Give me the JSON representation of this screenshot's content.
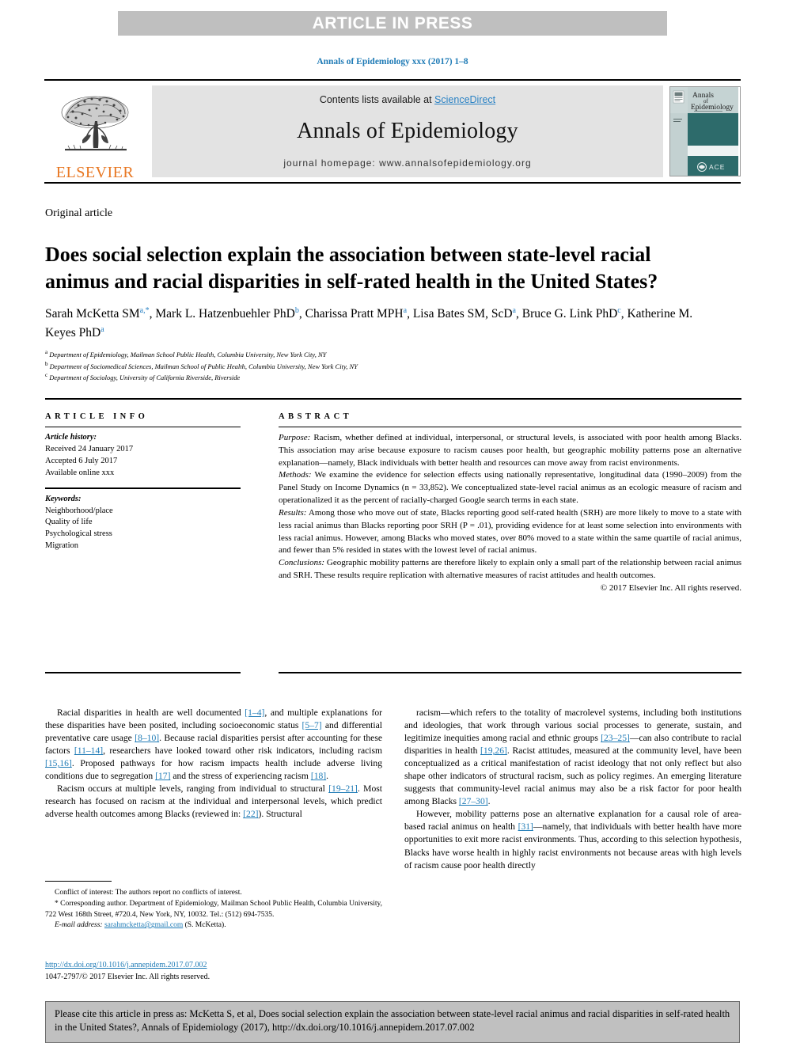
{
  "banner": {
    "text": "ARTICLE IN PRESS"
  },
  "journal_ref": "Annals of Epidemiology xxx (2017) 1–8",
  "masthead": {
    "publisher_wordmark": "ELSEVIER",
    "contents_prefix": "Contents lists available at ",
    "contents_link": "ScienceDirect",
    "journal_title": "Annals of Epidemiology",
    "homepage": "journal homepage: www.annalsofepidemiology.org",
    "cover": {
      "title_line1": "Annals",
      "title_line2": "of",
      "title_line3": "Epidemiology",
      "society": "ACE",
      "teal": "#2d6b6b"
    }
  },
  "article": {
    "type": "Original article",
    "title": "Does social selection explain the association between state-level racial animus and racial disparities in self-rated health in the United States?",
    "authors": [
      {
        "name": "Sarah McKetta SM",
        "marks": "a,*"
      },
      {
        "name": "Mark L. Hatzenbuehler PhD",
        "marks": "b"
      },
      {
        "name": "Charissa Pratt MPH",
        "marks": "a"
      },
      {
        "name": "Lisa Bates SM, ScD",
        "marks": "a"
      },
      {
        "name": "Bruce G. Link PhD",
        "marks": "c"
      },
      {
        "name": "Katherine M. Keyes PhD",
        "marks": "a"
      }
    ],
    "affiliations": [
      {
        "mark": "a",
        "text": "Department of Epidemiology, Mailman School Public Health, Columbia University, New York City, NY"
      },
      {
        "mark": "b",
        "text": "Department of Sociomedical Sciences, Mailman School of Public Health, Columbia University, New York City, NY"
      },
      {
        "mark": "c",
        "text": "Department of Sociology, University of California Riverside, Riverside"
      }
    ]
  },
  "article_info": {
    "heading": "ARTICLE INFO",
    "history_label": "Article history:",
    "history": [
      "Received 24 January 2017",
      "Accepted 6 July 2017",
      "Available online xxx"
    ],
    "keywords_label": "Keywords:",
    "keywords": [
      "Neighborhood/place",
      "Quality of life",
      "Psychological stress",
      "Migration"
    ]
  },
  "abstract": {
    "heading": "ABSTRACT",
    "purpose_label": "Purpose:",
    "purpose": " Racism, whether defined at individual, interpersonal, or structural levels, is associated with poor health among Blacks. This association may arise because exposure to racism causes poor health, but geographic mobility patterns pose an alternative explanation—namely, Black individuals with better health and resources can move away from racist environments.",
    "methods_label": "Methods:",
    "methods": " We examine the evidence for selection effects using nationally representative, longitudinal data (1990–2009) from the Panel Study on Income Dynamics (n = 33,852). We conceptualized state-level racial animus as an ecologic measure of racism and operationalized it as the percent of racially-charged Google search terms in each state.",
    "results_label": "Results:",
    "results": " Among those who move out of state, Blacks reporting good self-rated health (SRH) are more likely to move to a state with less racial animus than Blacks reporting poor SRH (P = .01), providing evidence for at least some selection into environments with less racial animus. However, among Blacks who moved states, over 80% moved to a state within the same quartile of racial animus, and fewer than 5% resided in states with the lowest level of racial animus.",
    "conclusions_label": "Conclusions:",
    "conclusions": " Geographic mobility patterns are therefore likely to explain only a small part of the relationship between racial animus and SRH. These results require replication with alternative measures of racist attitudes and health outcomes.",
    "copyright": "© 2017 Elsevier Inc. All rights reserved."
  },
  "body": {
    "left": [
      "Racial disparities in health are well documented [1–4], and multiple explanations for these disparities have been posited, including socioeconomic status [5–7] and differential preventative care usage [8–10]. Because racial disparities persist after accounting for these factors [11–14], researchers have looked toward other risk indicators, including racism [15,16]. Proposed pathways for how racism impacts health include adverse living conditions due to segregation [17] and the stress of experiencing racism [18].",
      "Racism occurs at multiple levels, ranging from individual to structural [19–21]. Most research has focused on racism at the individual and interpersonal levels, which predict adverse health outcomes among Blacks (reviewed in: [22]). Structural"
    ],
    "right": [
      "racism—which refers to the totality of macrolevel systems, including both institutions and ideologies, that work through various social processes to generate, sustain, and legitimize inequities among racial and ethnic groups [23–25]—can also contribute to racial disparities in health [19,26]. Racist attitudes, measured at the community level, have been conceptualized as a critical manifestation of racist ideology that not only reflect but also shape other indicators of structural racism, such as policy regimes. An emerging literature suggests that community-level racial animus may also be a risk factor for poor health among Blacks [27–30].",
      "However, mobility patterns pose an alternative explanation for a causal role of area-based racial animus on health [31]—namely, that individuals with better health have more opportunities to exit more racist environments. Thus, according to this selection hypothesis, Blacks have worse health in highly racist environments not because areas with high levels of racism cause poor health directly"
    ]
  },
  "footnotes": {
    "conflict": "Conflict of interest: The authors report no conflicts of interest.",
    "corresponding": "* Corresponding author. Department of Epidemiology, Mailman School Public Health, Columbia University, 722 West 168th Street, #720.4, New York, NY, 10032. Tel.: (512) 694-7535.",
    "email_label": "E-mail address:",
    "email": "sarahmcketta@gmail.com",
    "email_suffix": " (S. McKetta)."
  },
  "doi_block": {
    "doi_url": "http://dx.doi.org/10.1016/j.annepidem.2017.07.002",
    "issn_line": "1047-2797/© 2017 Elsevier Inc. All rights reserved."
  },
  "cite_footer": {
    "text": "Please cite this article in press as: McKetta S, et al, Does social selection explain the association between state-level racial animus and racial disparities in self-rated health in the United States?, Annals of Epidemiology (2017), http://dx.doi.org/10.1016/j.annepidem.2017.07.002"
  },
  "colors": {
    "link_blue": "#1f7bb6",
    "banner_gray": "#bfbfbf",
    "masthead_gray": "#e3e3e3",
    "elsevier_orange": "#e87722",
    "cite_gray": "#c0c0c0"
  }
}
